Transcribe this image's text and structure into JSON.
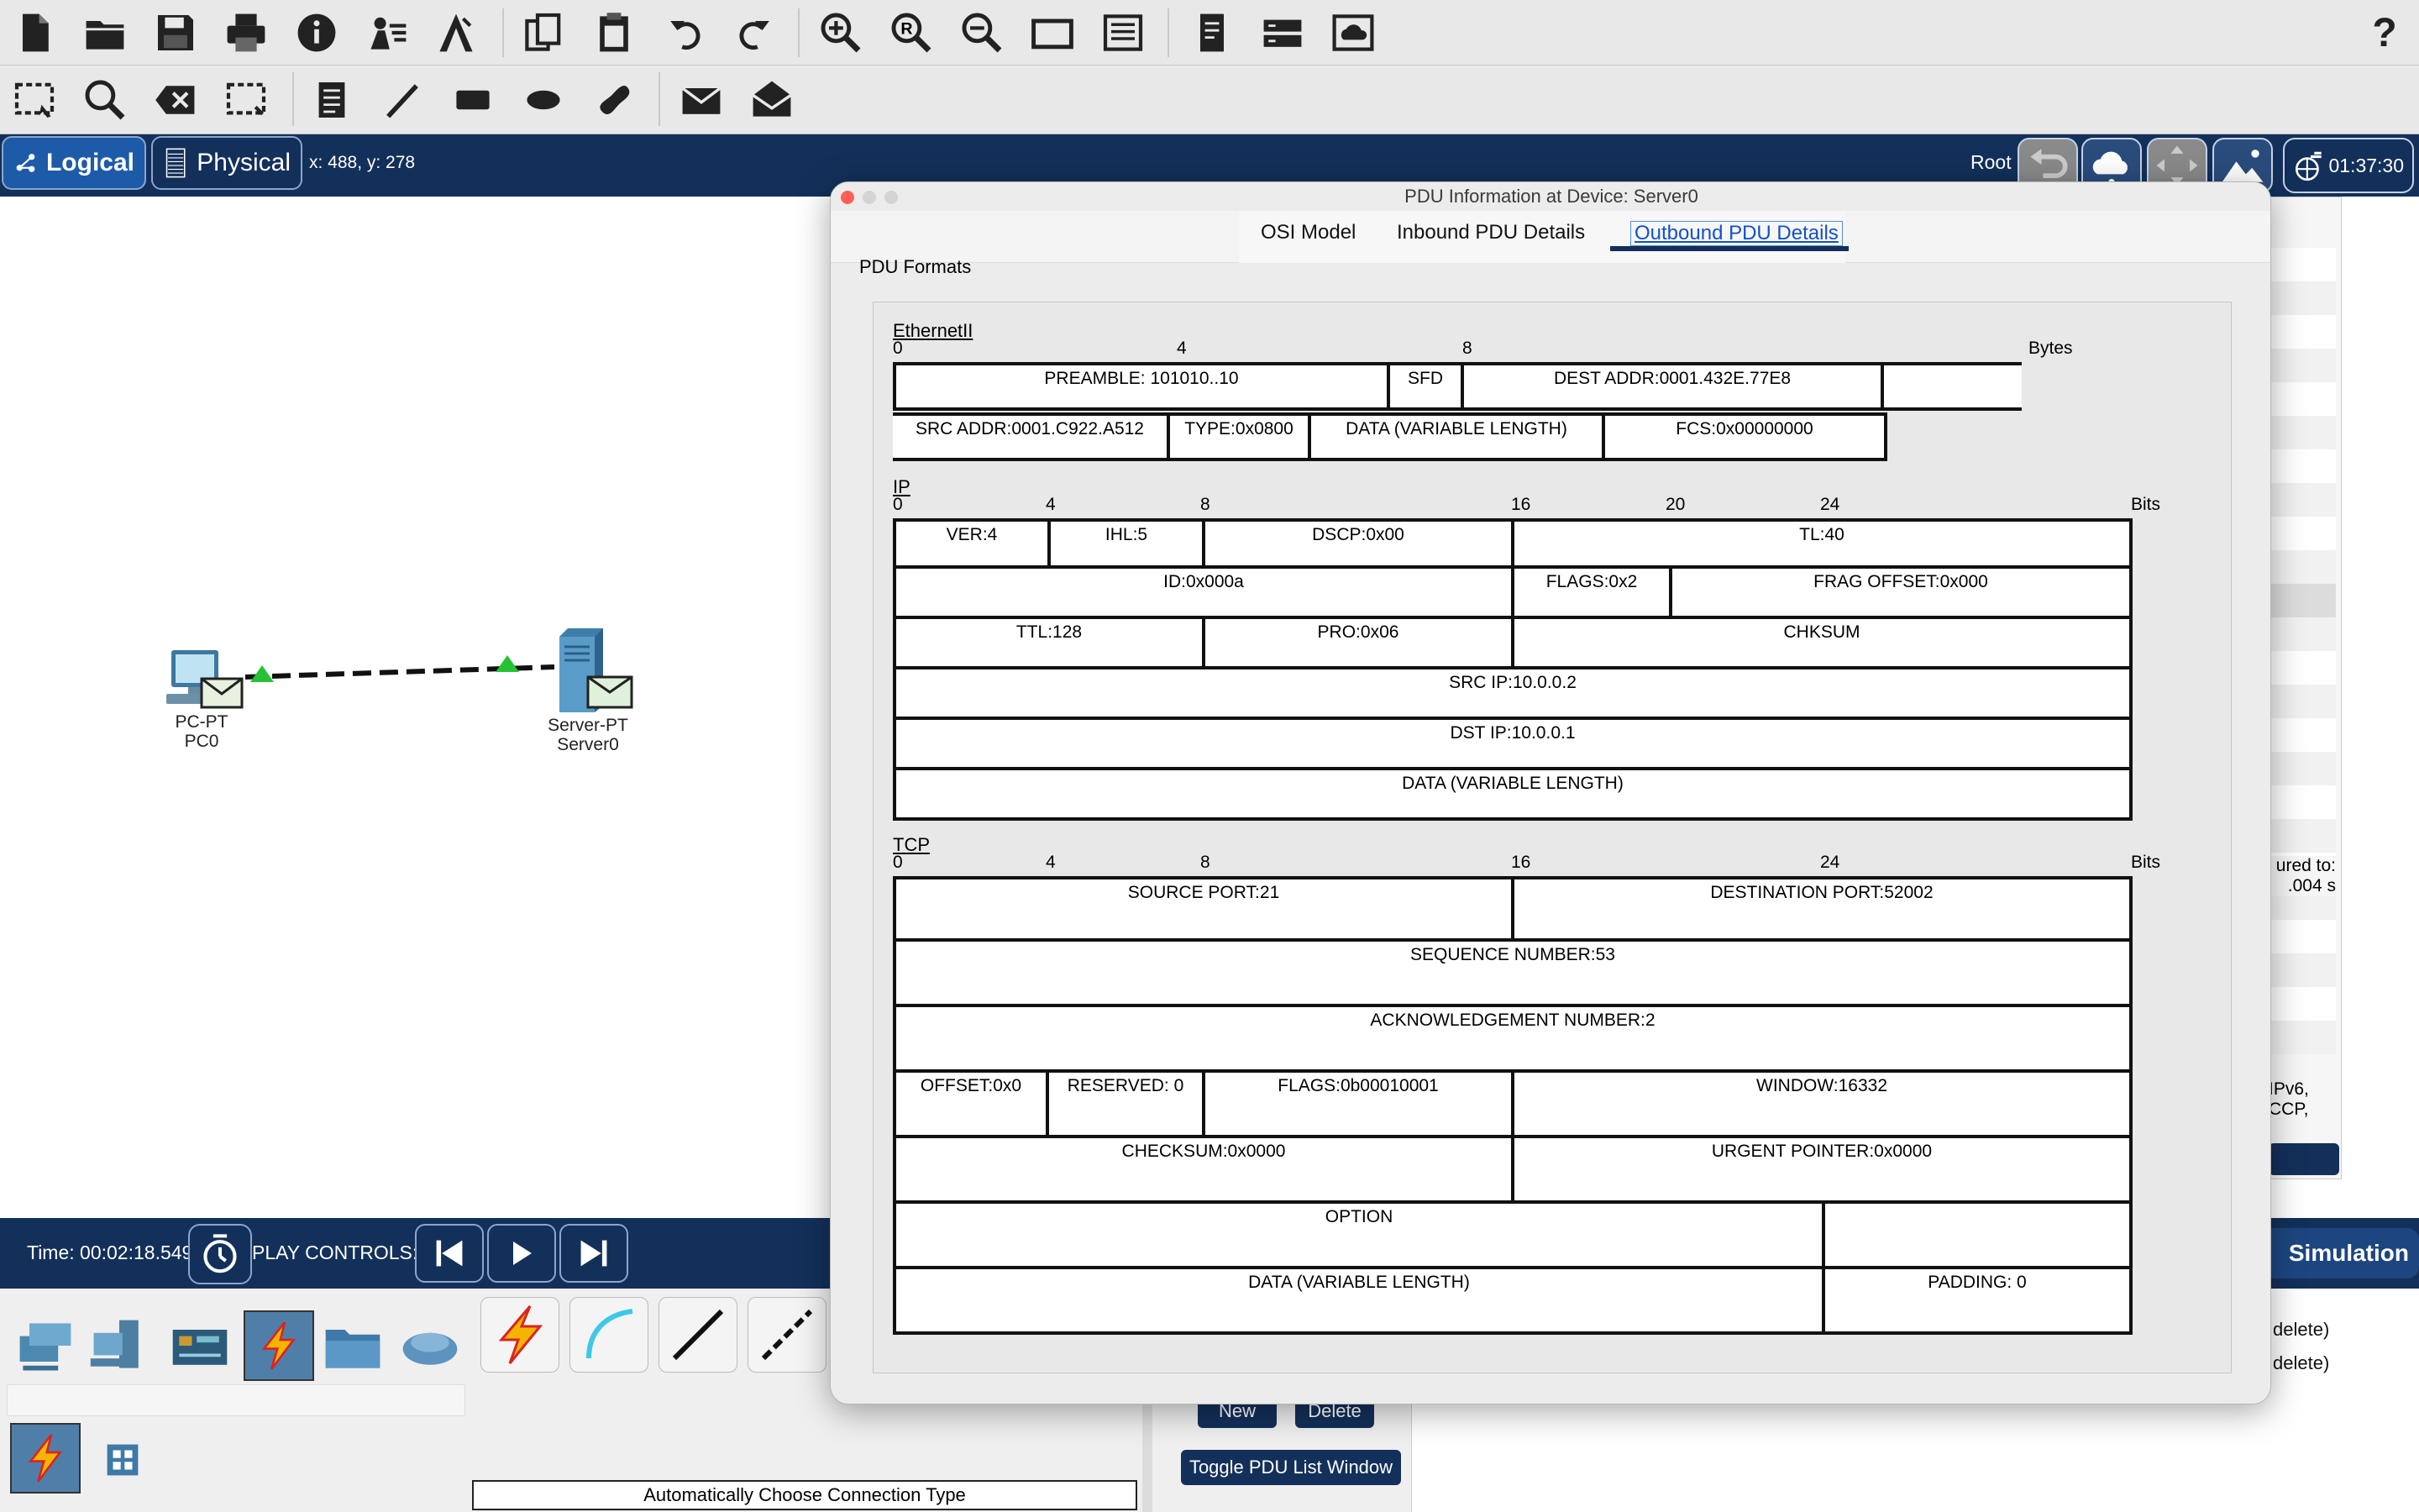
{
  "toolbar_top": {
    "icons": [
      "new-file-icon",
      "open-folder-icon",
      "save-icon",
      "print-icon",
      "info-icon",
      "activity-wizard-icon",
      "custom-device-icon",
      "copy-icon",
      "paste-icon",
      "undo-icon",
      "redo-icon",
      "zoom-in-icon",
      "zoom-reset-icon",
      "zoom-out-icon",
      "drawing-palette-icon",
      "custom-devices-dialog-icon",
      "viewport-icon",
      "network-info-icon",
      "pdu-cloud-icon",
      "help-icon"
    ],
    "help": "?"
  },
  "toolbar_second": {
    "icons": [
      "select-icon",
      "inspect-icon",
      "delete-icon",
      "resize-icon",
      "note-icon",
      "line-draw-icon",
      "rectangle-icon",
      "ellipse-icon",
      "freeform-icon",
      "simple-pdu-icon",
      "complex-pdu-icon"
    ]
  },
  "nav": {
    "logical": "Logical",
    "physical": "Physical",
    "coords": "x: 488, y: 278",
    "root": "Root",
    "clock": "01:37:30"
  },
  "canvas": {
    "pc_type": "PC-PT",
    "pc_name": "PC0",
    "server_type": "Server-PT",
    "server_name": "Server0"
  },
  "background_panel": {
    "captured_line1": "ured to:",
    "captured_line2": ".004 s",
    "filter_line1": "IPv6,",
    "filter_line2": "CCP,"
  },
  "sim": {
    "time": "Time: 00:02:18.549",
    "play_controls": "PLAY CONTROLS:",
    "simulation": "Simulation"
  },
  "bottom": {
    "auto_connection": "Automatically Choose Connection Type",
    "new": "New",
    "delete": "Delete",
    "toggle_pdu": "Toggle PDU List Window",
    "delete_row1": "delete)",
    "delete_row2": "delete)"
  },
  "dialog": {
    "title": "PDU Information at Device: Server0",
    "tabs": [
      "OSI Model",
      "Inbound PDU Details",
      "Outbound PDU Details"
    ],
    "active_tab": "Outbound PDU Details",
    "section_title": "PDU Formats",
    "ethernet": {
      "label": "EthernetII",
      "ticks": [
        "0",
        "4",
        "8"
      ],
      "unit": "Bytes",
      "preamble": "PREAMBLE: 101010..10",
      "sfd": "SFD",
      "dest": "DEST ADDR:0001.432E.77E8",
      "src": "SRC ADDR:0001.C922.A512",
      "type": "TYPE:0x0800",
      "data": "DATA (VARIABLE LENGTH)",
      "fcs": "FCS:0x00000000"
    },
    "ip": {
      "label": "IP",
      "ticks": [
        "0",
        "4",
        "8",
        "16",
        "20",
        "24"
      ],
      "unit": "Bits",
      "ver": "VER:4",
      "ihl": "IHL:5",
      "dscp": "DSCP:0x00",
      "tl": "TL:40",
      "id": "ID:0x000a",
      "flags": "FLAGS:0x2",
      "frag": "FRAG OFFSET:0x000",
      "ttl": "TTL:128",
      "pro": "PRO:0x06",
      "chksum": "CHKSUM",
      "src": "SRC IP:10.0.0.2",
      "dst": "DST IP:10.0.0.1",
      "data": "DATA (VARIABLE LENGTH)"
    },
    "tcp": {
      "label": "TCP",
      "ticks": [
        "0",
        "4",
        "8",
        "16",
        "24"
      ],
      "unit": "Bits",
      "src_port": "SOURCE PORT:21",
      "dst_port": "DESTINATION PORT:52002",
      "seq": "SEQUENCE NUMBER:53",
      "ack": "ACKNOWLEDGEMENT NUMBER:2",
      "offset": "OFFSET:0x0",
      "reserved": "RESERVED: 0",
      "flags": "FLAGS:0b00010001",
      "window": "WINDOW:16332",
      "checksum": "CHECKSUM:0x0000",
      "urgent": "URGENT POINTER:0x0000",
      "option": "OPTION",
      "data": "DATA (VARIABLE LENGTH)",
      "padding": "PADDING: 0"
    }
  },
  "colors": {
    "nav_bg": "#13305a",
    "link_active": "#1450c8"
  }
}
